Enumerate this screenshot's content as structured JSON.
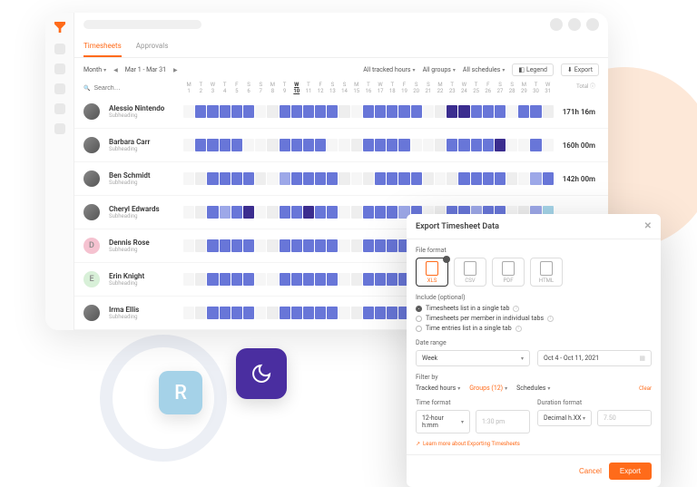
{
  "tabs": {
    "timesheets": "Timesheets",
    "approvals": "Approvals"
  },
  "filters": {
    "period": "Month",
    "range": "Mar 1 - Mar 31",
    "hours": "All tracked hours",
    "groups": "All groups",
    "schedules": "All schedules",
    "legend": "Legend",
    "export": "Export"
  },
  "search_placeholder": "Search…",
  "day_headers": [
    "M",
    "T",
    "W",
    "T",
    "F",
    "S",
    "S",
    "M",
    "T",
    "W",
    "T",
    "F",
    "S",
    "S",
    "M",
    "T",
    "W",
    "T",
    "F",
    "S",
    "S",
    "M",
    "T",
    "W",
    "T",
    "F",
    "S",
    "S",
    "M",
    "T",
    "W"
  ],
  "day_nums": [
    "1",
    "2",
    "3",
    "4",
    "5",
    "6",
    "7",
    "8",
    "9",
    "10",
    "11",
    "12",
    "13",
    "14",
    "15",
    "16",
    "17",
    "18",
    "19",
    "20",
    "21",
    "22",
    "23",
    "24",
    "25",
    "26",
    "27",
    "28",
    "29",
    "30",
    "31"
  ],
  "today_idx": 9,
  "total_label": "Total",
  "subheading": "Subheading",
  "users": [
    {
      "name": "Alessio Nintendo",
      "avatar": "photo",
      "total": "171h 16m",
      "cells": [
        0,
        3,
        3,
        3,
        3,
        3,
        0,
        1,
        3,
        3,
        3,
        3,
        3,
        1,
        0,
        3,
        3,
        3,
        3,
        3,
        0,
        1,
        5,
        5,
        3,
        3,
        3,
        0,
        3,
        3,
        1
      ]
    },
    {
      "name": "Barbara Carr",
      "avatar": "photo",
      "total": "160h 00m",
      "cells": [
        0,
        3,
        3,
        3,
        3,
        0,
        0,
        1,
        3,
        3,
        3,
        3,
        0,
        0,
        1,
        3,
        3,
        3,
        3,
        0,
        0,
        1,
        3,
        3,
        3,
        3,
        5,
        0,
        0,
        3,
        0
      ]
    },
    {
      "name": "Ben Schmidt",
      "avatar": "photo",
      "total": "142h 00m",
      "cells": [
        0,
        1,
        3,
        3,
        3,
        3,
        1,
        0,
        2,
        3,
        3,
        3,
        3,
        1,
        0,
        1,
        3,
        3,
        3,
        3,
        1,
        0,
        1,
        3,
        3,
        3,
        3,
        1,
        0,
        2,
        3
      ]
    },
    {
      "name": "Cheryl Edwards",
      "avatar": "photo",
      "total": "",
      "cells": [
        0,
        1,
        3,
        2,
        3,
        5,
        0,
        1,
        3,
        3,
        5,
        3,
        3,
        0,
        1,
        3,
        3,
        3,
        2,
        3,
        0,
        1,
        3,
        3,
        2,
        3,
        3,
        0,
        1,
        2,
        6
      ]
    },
    {
      "name": "Dennis Rose",
      "avatar": "D",
      "total": "",
      "cells": [
        0,
        1,
        3,
        3,
        3,
        3,
        0,
        1,
        3,
        3,
        3,
        3,
        3,
        0,
        1,
        3,
        3,
        3,
        3,
        3,
        0,
        1,
        3,
        3,
        3,
        3,
        3,
        0,
        0,
        0,
        0
      ]
    },
    {
      "name": "Erin Knight",
      "avatar": "E",
      "total": "",
      "cells": [
        0,
        1,
        3,
        3,
        3,
        3,
        0,
        0,
        3,
        3,
        3,
        3,
        3,
        0,
        1,
        3,
        3,
        3,
        3,
        3,
        0,
        0,
        0,
        0,
        0,
        0,
        0,
        0,
        0,
        0,
        0
      ]
    },
    {
      "name": "Irma Ellis",
      "avatar": "photo",
      "total": "",
      "cells": [
        0,
        1,
        3,
        3,
        3,
        3,
        0,
        1,
        3,
        3,
        3,
        3,
        3,
        0,
        1,
        3,
        3,
        3,
        3,
        3,
        0,
        1,
        3,
        3,
        3,
        3,
        3,
        0,
        0,
        0,
        0
      ]
    }
  ],
  "modal": {
    "title": "Export Timesheet Data",
    "file_format": "File format",
    "formats": [
      "XLS",
      "CSV",
      "PDF",
      "HTML"
    ],
    "include": "Include (optional)",
    "inc1": "Timesheets list in a single tab",
    "inc2": "Timesheets per member in individual tabs",
    "inc3": "Time entries list in a single tab",
    "date_range": "Date range",
    "dr_period": "Week",
    "dr_dates": "Oct 4 - Oct 11, 2021",
    "filter_by": "Filter by",
    "f_hours": "Tracked hours",
    "f_groups": "Groups (12)",
    "f_sched": "Schedules",
    "clear": "Clear",
    "time_format": "Time format",
    "tf1": "12-hour h:mm",
    "tf2": "1:30 pm",
    "duration_format": "Duration format",
    "df1": "Decimal h.XX",
    "df2": "7.50",
    "learn": "Learn more about Exporting Timesheets",
    "cancel": "Cancel",
    "export": "Export"
  },
  "float_r": "R"
}
